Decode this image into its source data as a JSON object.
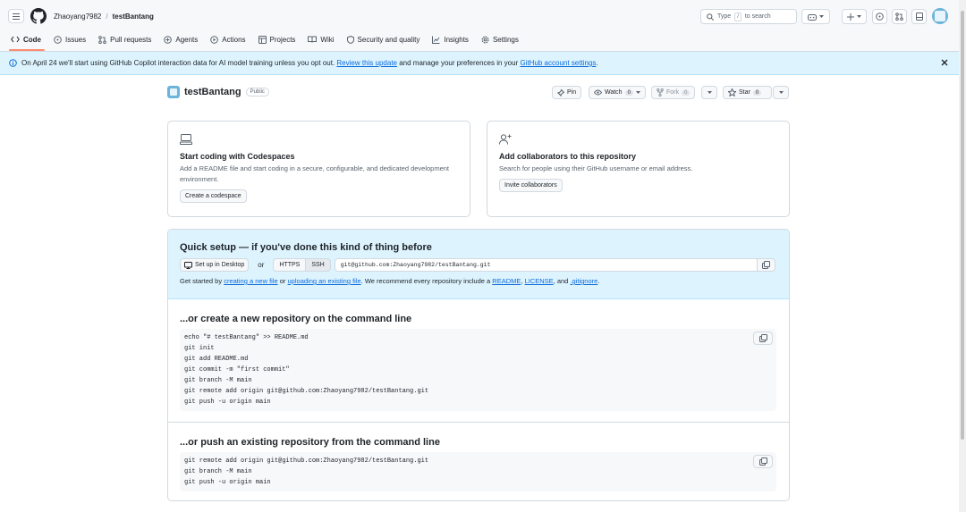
{
  "header": {
    "owner": "Zhaoyang7982",
    "separator": "/",
    "repo": "testBantang",
    "search_prefix": "Type",
    "search_key": "/",
    "search_suffix": "to search"
  },
  "tabs": [
    {
      "label": "Code",
      "icon": "code-icon"
    },
    {
      "label": "Issues",
      "icon": "issue-icon"
    },
    {
      "label": "Pull requests",
      "icon": "pull-request-icon"
    },
    {
      "label": "Agents",
      "icon": "agents-icon"
    },
    {
      "label": "Actions",
      "icon": "play-icon"
    },
    {
      "label": "Projects",
      "icon": "table-icon"
    },
    {
      "label": "Wiki",
      "icon": "book-icon"
    },
    {
      "label": "Security and quality",
      "icon": "shield-icon"
    },
    {
      "label": "Insights",
      "icon": "graph-icon"
    },
    {
      "label": "Settings",
      "icon": "gear-icon"
    }
  ],
  "banner": {
    "text1": "On April 24 we'll start using GitHub Copilot interaction data for AI model training unless you opt out.",
    "link1": "Review this update",
    "text2": "and manage your preferences in your",
    "link2": "GitHub account settings",
    "text3": "."
  },
  "repo": {
    "name": "testBantang",
    "visibility": "Public",
    "pin": "Pin",
    "watch": "Watch",
    "watch_count": "0",
    "fork": "Fork",
    "fork_count": "0",
    "star": "Star",
    "star_count": "0"
  },
  "cards": {
    "codespaces": {
      "title": "Start coding with Codespaces",
      "desc": "Add a README file and start coding in a secure, configurable, and dedicated development environment.",
      "button": "Create a codespace"
    },
    "collaborators": {
      "title": "Add collaborators to this repository",
      "desc": "Search for people using their GitHub username or email address.",
      "button": "Invite collaborators"
    }
  },
  "quick_setup": {
    "title": "Quick setup — if you've done this kind of thing before",
    "desktop": "Set up in Desktop",
    "or": "or",
    "https": "HTTPS",
    "ssh": "SSH",
    "url": "git@github.com:Zhaoyang7982/testBantang.git",
    "help1": "Get started by",
    "link_new": "creating a new file",
    "help2": "or",
    "link_upload": "uploading an existing file",
    "help3": ". We recommend every repository include a",
    "link_readme": "README",
    "comma": ",",
    "link_license": "LICENSE",
    "help4": ", and",
    "link_gitignore": ".gitignore",
    "help5": "."
  },
  "new_repo": {
    "title": "...or create a new repository on the command line",
    "lines": [
      "echo \"# testBantang\" >> README.md",
      "git init",
      "git add README.md",
      "git commit -m \"first commit\"",
      "git branch -M main",
      "git remote add origin git@github.com:Zhaoyang7982/testBantang.git",
      "git push -u origin main"
    ]
  },
  "push_repo": {
    "title": "...or push an existing repository from the command line",
    "lines": [
      "git remote add origin git@github.com:Zhaoyang7982/testBantang.git",
      "git branch -M main",
      "git push -u origin main"
    ]
  }
}
